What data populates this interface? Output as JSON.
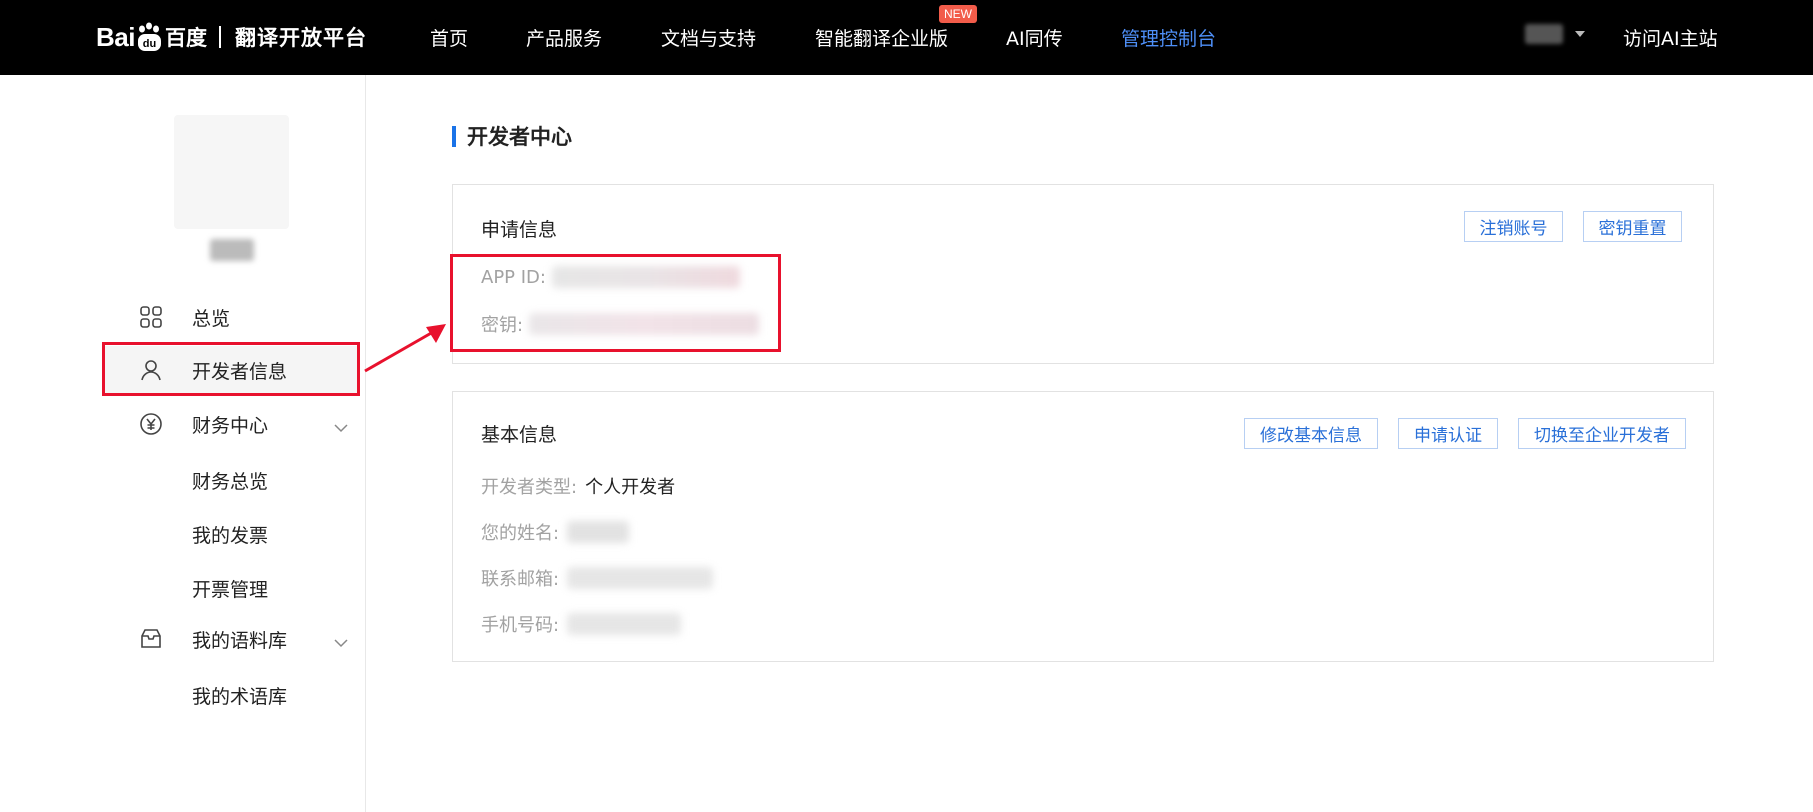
{
  "topbar": {
    "logo_bai": "Bai",
    "logo_du": "du",
    "logo_cn": "百度",
    "product": "翻译开放平台",
    "nav": [
      "首页",
      "产品服务",
      "文档与支持",
      "智能翻译企业版",
      "AI同传",
      "管理控制台"
    ],
    "badge": "NEW",
    "visit": "访问AI主站"
  },
  "sidebar": {
    "overview": "总览",
    "developer_info": "开发者信息",
    "finance_center": "财务中心",
    "finance_overview": "财务总览",
    "my_invoices": "我的发票",
    "invoice_mgmt": "开票管理",
    "my_corpus": "我的语料库",
    "my_terms": "我的术语库"
  },
  "main": {
    "title": "开发者中心",
    "apply_info": {
      "title": "申请信息",
      "btn_cancel_account": "注销账号",
      "btn_reset_key": "密钥重置",
      "app_id_label": "APP ID:",
      "key_label": "密钥:"
    },
    "basic_info": {
      "title": "基本信息",
      "btn_edit": "修改基本信息",
      "btn_certify": "申请认证",
      "btn_switch": "切换至企业开发者",
      "type_label": "开发者类型:",
      "type_value": "个人开发者",
      "name_label": "您的姓名:",
      "email_label": "联系邮箱:",
      "phone_label": "手机号码:"
    }
  },
  "colors": {
    "accent": "#1a73e8",
    "nav_active": "#4e8ff7",
    "highlight": "#e8112d",
    "badge": "#f25c4a"
  }
}
